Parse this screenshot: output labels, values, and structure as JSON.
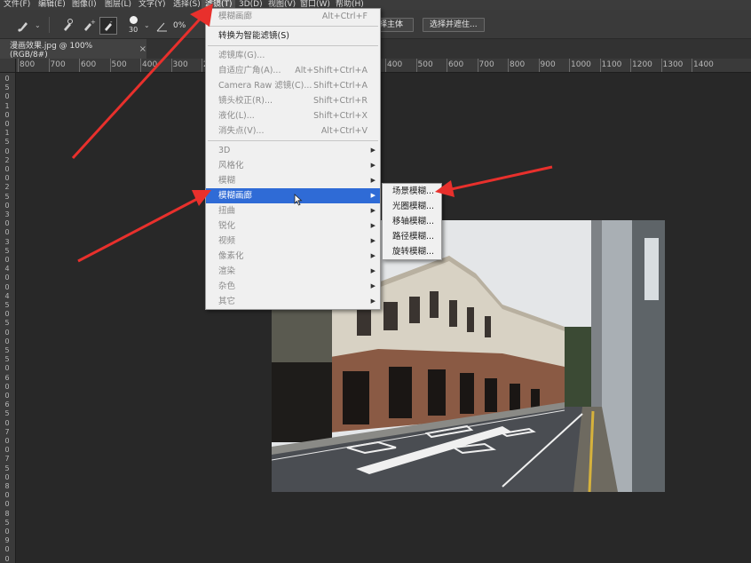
{
  "menubar": {
    "items": [
      {
        "label": "文件(F)"
      },
      {
        "label": "编辑(E)"
      },
      {
        "label": "图像(I)"
      },
      {
        "label": "图层(L)"
      },
      {
        "label": "文字(Y)"
      },
      {
        "label": "选择(S)"
      },
      {
        "label": "滤镜(T)"
      },
      {
        "label": "3D(D)"
      },
      {
        "label": "视图(V)"
      },
      {
        "label": "窗口(W)"
      },
      {
        "label": "帮助(H)"
      }
    ]
  },
  "options_bar": {
    "brush_size": "30",
    "angle_partial": "0%",
    "select_subject_label": "择主体",
    "select_and_mask_label": "选择并遮住..."
  },
  "document_tab": {
    "title": "漫画效果.jpg @ 100%(RGB/8#)",
    "close": "×"
  },
  "h_ruler": {
    "labels": [
      "800",
      "700",
      "600",
      "500",
      "400",
      "300",
      "200",
      "100",
      "0",
      "100",
      "200",
      "300",
      "400",
      "500",
      "600",
      "700",
      "800",
      "900",
      "1000",
      "1100",
      "1200",
      "1300",
      "1400"
    ]
  },
  "v_ruler": {
    "labels": [
      "0",
      "5",
      "0",
      "1",
      "0",
      "0",
      "1",
      "5",
      "0",
      "2",
      "0",
      "0",
      "2",
      "5",
      "0",
      "3",
      "0",
      "0",
      "3",
      "5",
      "0",
      "4",
      "0",
      "0",
      "4",
      "5",
      "0",
      "5",
      "0",
      "0",
      "5",
      "5",
      "0",
      "6",
      "0",
      "0",
      "6",
      "5",
      "0",
      "7",
      "0",
      "0",
      "7",
      "5",
      "0",
      "8",
      "0",
      "0",
      "8",
      "5",
      "0",
      "9",
      "0",
      "0"
    ]
  },
  "filter_menu": {
    "items": [
      {
        "label": "模糊画廊",
        "shortcut": "Alt+Ctrl+F",
        "enabled": false
      },
      {
        "sep": true
      },
      {
        "label": "转换为智能滤镜(S)",
        "enabled": true
      },
      {
        "sep": true
      },
      {
        "label": "滤镜库(G)...",
        "enabled": false
      },
      {
        "label": "自适应广角(A)...",
        "shortcut": "Alt+Shift+Ctrl+A",
        "enabled": false
      },
      {
        "label": "Camera Raw 滤镜(C)...",
        "shortcut": "Shift+Ctrl+A",
        "enabled": false
      },
      {
        "label": "镜头校正(R)...",
        "shortcut": "Shift+Ctrl+R",
        "enabled": false
      },
      {
        "label": "液化(L)...",
        "shortcut": "Shift+Ctrl+X",
        "enabled": false
      },
      {
        "label": "消失点(V)...",
        "shortcut": "Alt+Ctrl+V",
        "enabled": false
      },
      {
        "sep": true
      },
      {
        "label": "3D",
        "submenu": true,
        "enabled": false
      },
      {
        "label": "风格化",
        "submenu": true,
        "enabled": false
      },
      {
        "label": "模糊",
        "submenu": true,
        "enabled": false
      },
      {
        "label": "模糊画廊",
        "submenu": true,
        "enabled": true,
        "highlighted": true
      },
      {
        "label": "扭曲",
        "submenu": true,
        "enabled": false
      },
      {
        "label": "锐化",
        "submenu": true,
        "enabled": false
      },
      {
        "label": "视频",
        "submenu": true,
        "enabled": false
      },
      {
        "label": "像素化",
        "submenu": true,
        "enabled": false
      },
      {
        "label": "渲染",
        "submenu": true,
        "enabled": false
      },
      {
        "label": "杂色",
        "submenu": true,
        "enabled": false
      },
      {
        "label": "其它",
        "submenu": true,
        "enabled": false
      }
    ]
  },
  "blur_gallery_submenu": {
    "items": [
      {
        "label": "场景模糊..."
      },
      {
        "label": "光圈模糊..."
      },
      {
        "label": "移轴模糊..."
      },
      {
        "label": "路径模糊..."
      },
      {
        "label": "旋转模糊..."
      }
    ]
  },
  "colors": {
    "accent": "#2f6bd6",
    "annotation_arrow": "#e8302c",
    "canvas_bg": "#282828",
    "menu_bg": "#f0f0f0"
  }
}
